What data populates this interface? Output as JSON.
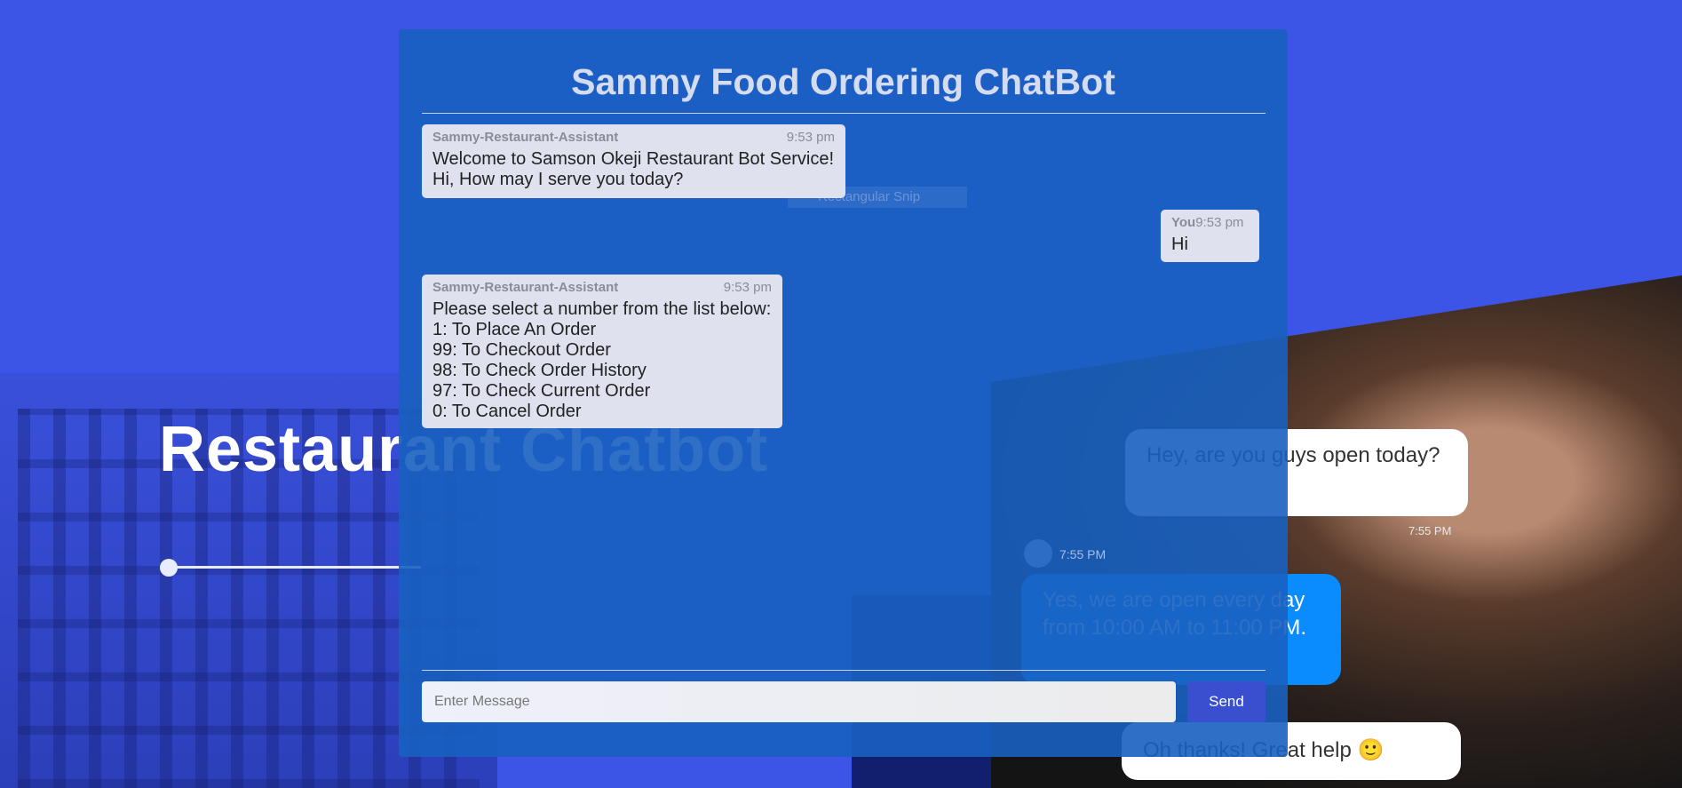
{
  "hero": {
    "title": "Restaurant Chatbot"
  },
  "background_chat": {
    "user_message": "Hey, are you guys open today?",
    "user_time": "7:55 PM",
    "bot_time": "7:55 PM",
    "bot_message": "Yes, we are open every day from 10:00 AM to 11:00 PM.",
    "user_reply": "Oh thanks! Great help 🙂"
  },
  "chat": {
    "title": "Sammy Food Ordering ChatBot",
    "overlay_text": "Rectangular Snip",
    "messages": [
      {
        "sender": "Sammy-Restaurant-Assistant",
        "time": "9:53 pm",
        "lines": [
          "Welcome to Samson Okeji Restaurant Bot Service!",
          "Hi, How may I serve you today?"
        ]
      },
      {
        "sender": "You",
        "time": "9:53 pm",
        "lines": [
          "Hi"
        ]
      },
      {
        "sender": "Sammy-Restaurant-Assistant",
        "time": "9:53 pm",
        "lines": [
          "Please select a number from the list below:",
          "1: To Place An Order",
          "99: To Checkout Order",
          "98: To Check Order History",
          "97: To Check Current Order",
          "0: To Cancel Order"
        ]
      }
    ],
    "input_placeholder": "Enter Message",
    "input_value": "",
    "send_label": "Send"
  },
  "colors": {
    "background": "#3d55e6",
    "panel": "#1860c0",
    "bubble": "#dfe1ee",
    "send": "#3a4fd0"
  }
}
